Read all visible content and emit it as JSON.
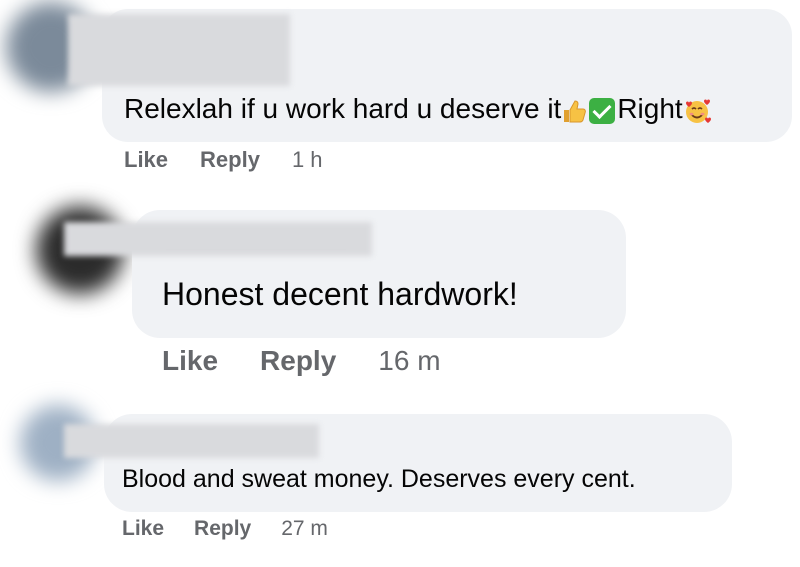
{
  "comments": [
    {
      "text": "Relexlah if u work hard u deserve it",
      "emoji_text": "Right",
      "emojis": [
        "thumbs-up-icon",
        "check-mark-button-icon",
        "smiling-face-with-hearts-icon"
      ],
      "like_label": "Like",
      "reply_label": "Reply",
      "time": "1 h"
    },
    {
      "text": "Honest decent hardwork!",
      "like_label": "Like",
      "reply_label": "Reply",
      "time": "16 m"
    },
    {
      "text": "Blood and sweat money. Deserves every cent.",
      "like_label": "Like",
      "reply_label": "Reply",
      "time": "27 m"
    }
  ],
  "colors": {
    "bubble": "#f0f2f5",
    "secondary_text": "#65676b",
    "primary_text": "#050505",
    "check": "#3cb043"
  }
}
